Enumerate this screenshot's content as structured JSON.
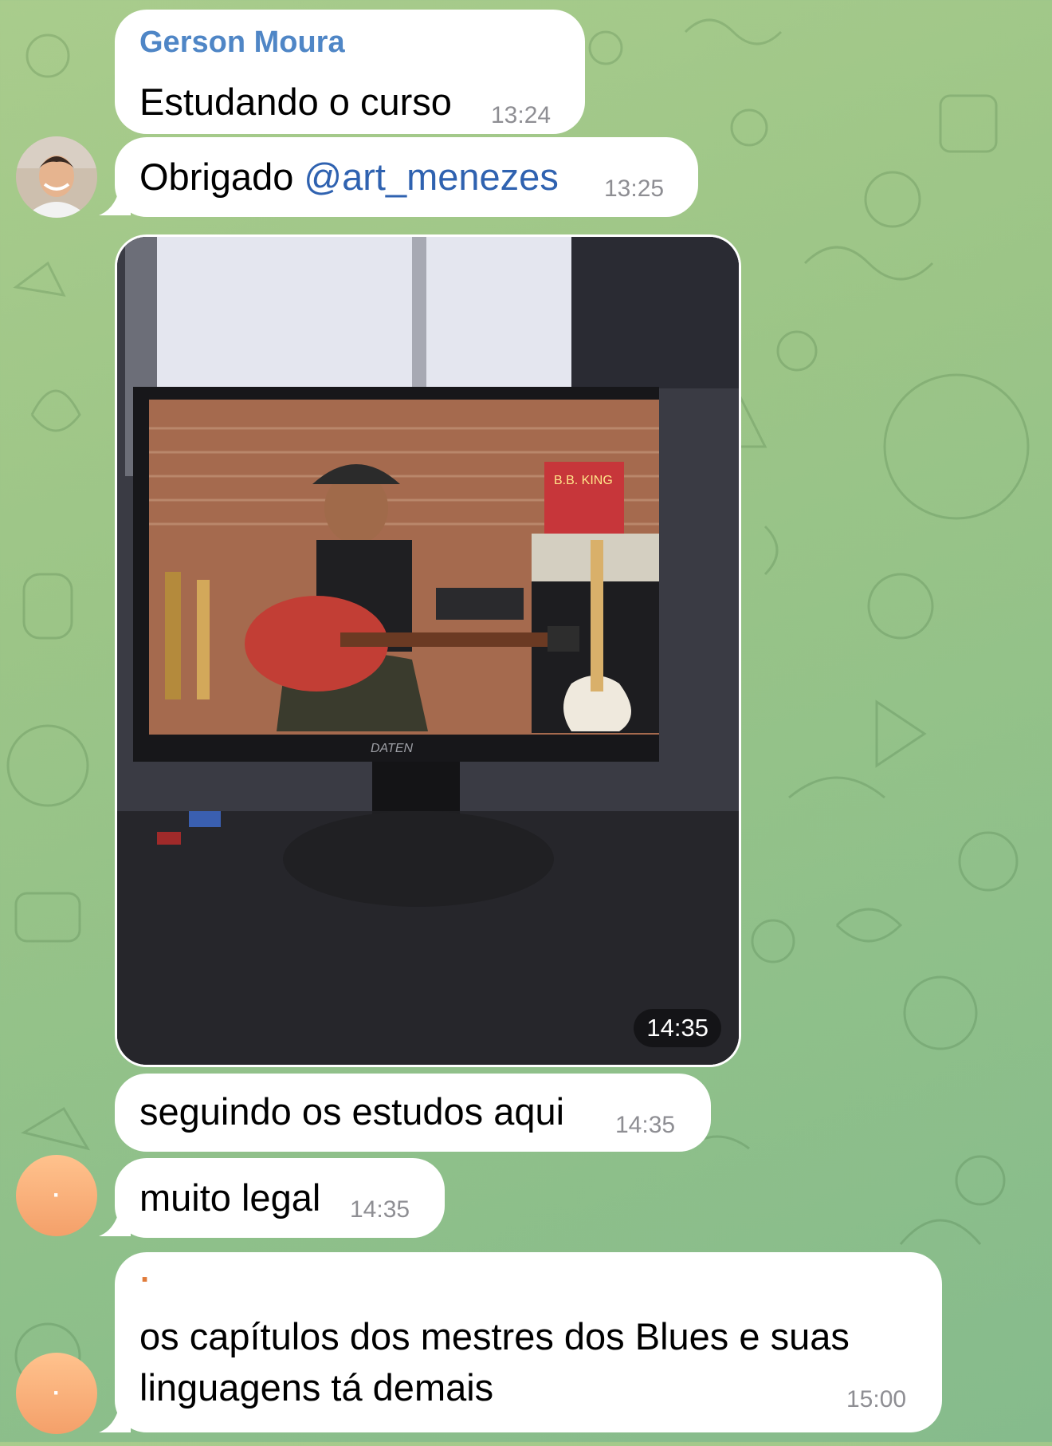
{
  "messages": [
    {
      "sender": "Gerson Moura",
      "text": "Estudando o curso",
      "time": "13:24"
    },
    {
      "text_before": "Obrigado ",
      "mention": "@art_menezes",
      "time": "13:25"
    },
    {
      "type": "photo",
      "time": "14:35",
      "monitor_brand": "DATEN",
      "poster_text": "B.B. KING"
    },
    {
      "text": "seguindo os estudos aqui",
      "time": "14:35"
    },
    {
      "text": "muito legal",
      "time": "14:35"
    },
    {
      "reply_marker": ".",
      "text_line1": "os capítulos dos mestres dos Blues e suas",
      "text_line2": "linguagens tá demais",
      "time": "15:00"
    }
  ],
  "avatars": {
    "orange_initial": "·"
  },
  "colors": {
    "bubble": "#ffffff",
    "sender_name": "#4f86c6",
    "mention": "#2f62b0",
    "timestamp": "#8e8e93",
    "background": "#9cc587",
    "avatar_orange": "#f4a06a"
  }
}
